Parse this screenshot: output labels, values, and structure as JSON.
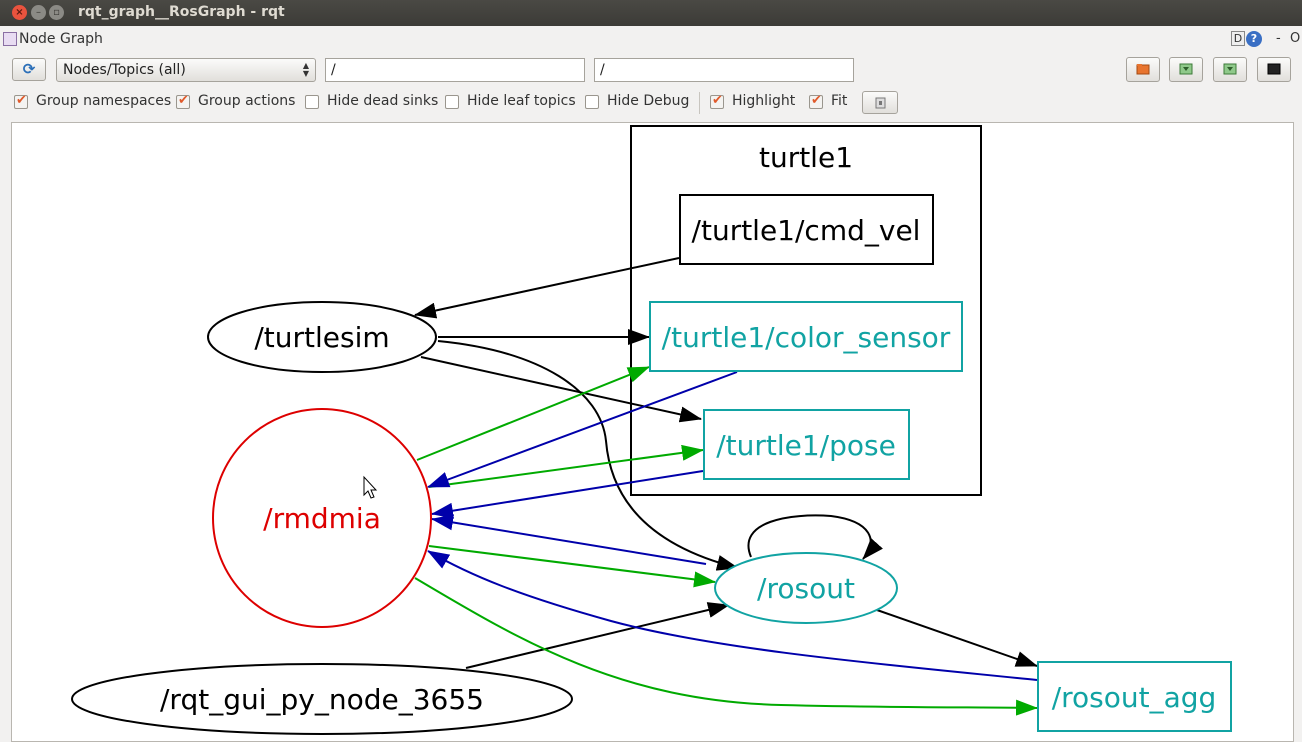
{
  "window": {
    "title": "rqt_graph__RosGraph - rqt"
  },
  "plugin": {
    "title": "Node Graph",
    "help_label": "D",
    "help_icon": "?",
    "minimize_label": "-",
    "close_label": "O"
  },
  "toolbar": {
    "mode_select": "Nodes/Topics (all)",
    "node_filter": "/",
    "topic_filter": "/"
  },
  "options": [
    {
      "label": "Group namespaces",
      "checked": true
    },
    {
      "label": "Group actions",
      "checked": true
    },
    {
      "label": "Hide dead sinks",
      "checked": false
    },
    {
      "label": "Hide leaf topics",
      "checked": false
    },
    {
      "label": "Hide Debug",
      "checked": false
    },
    {
      "label": "Highlight",
      "checked": true
    },
    {
      "label": "Fit",
      "checked": true
    }
  ],
  "graph": {
    "cluster": {
      "label": "turtle1"
    },
    "nodes": {
      "turtlesim": "/turtlesim",
      "rmdmia": "/rmdmia",
      "rqt_gui": "/rqt_gui_py_node_3655",
      "rosout": "/rosout"
    },
    "topics": {
      "cmd_vel": "/turtle1/cmd_vel",
      "color_sensor": "/turtle1/color_sensor",
      "pose": "/turtle1/pose",
      "rosout_agg": "/rosout_agg"
    },
    "colors": {
      "default": "#000000",
      "selected": "#dd0000",
      "highlight_node": "#11a3a3",
      "outgoing": "#00aa00",
      "incoming": "#0000aa"
    }
  }
}
